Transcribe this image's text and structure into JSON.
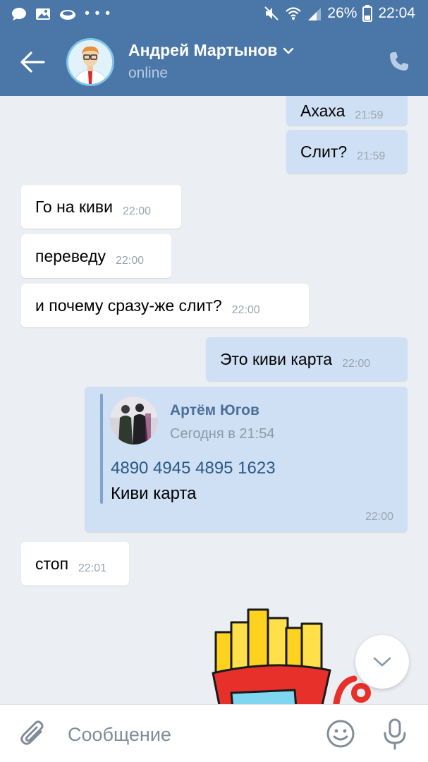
{
  "status_bar": {
    "dots": "• • •",
    "battery": "26%",
    "time": "22:04"
  },
  "header": {
    "name": "Андрей Мартынов",
    "status": "online"
  },
  "messages": [
    {
      "dir": "out",
      "text": "Ахаха",
      "time": "21:59"
    },
    {
      "dir": "out",
      "text": "Слит?",
      "time": "21:59"
    },
    {
      "dir": "in",
      "text": "Го на киви",
      "time": "22:00"
    },
    {
      "dir": "in",
      "text": "переведу",
      "time": "22:00"
    },
    {
      "dir": "in",
      "text": "и почему сразу-же слит?",
      "time": "22:00"
    },
    {
      "dir": "out",
      "text": "Это киви карта",
      "time": "22:00"
    }
  ],
  "forwarded": {
    "author": "Артём Югов",
    "date": "Сегодня в 21:54",
    "card_number": "4890 4945 4895 1623",
    "text": "Киви карта",
    "time": "22:00"
  },
  "last_message": {
    "dir": "in",
    "text": "стоп",
    "time": "22:01"
  },
  "input": {
    "placeholder": "Сообщение"
  },
  "colors": {
    "accent": "#4a76a8",
    "outgoing_bubble": "#cfe0f5",
    "incoming_bubble": "#ffffff",
    "background": "#ebeef3"
  },
  "icons": [
    "chat-icon",
    "image-icon",
    "cloud-icon",
    "mute-icon",
    "wifi-icon",
    "signal-icon",
    "battery-icon",
    "back-arrow-icon",
    "chevron-down-icon",
    "phone-icon",
    "paperclip-icon",
    "smile-icon",
    "microphone-icon",
    "scroll-down-icon"
  ]
}
